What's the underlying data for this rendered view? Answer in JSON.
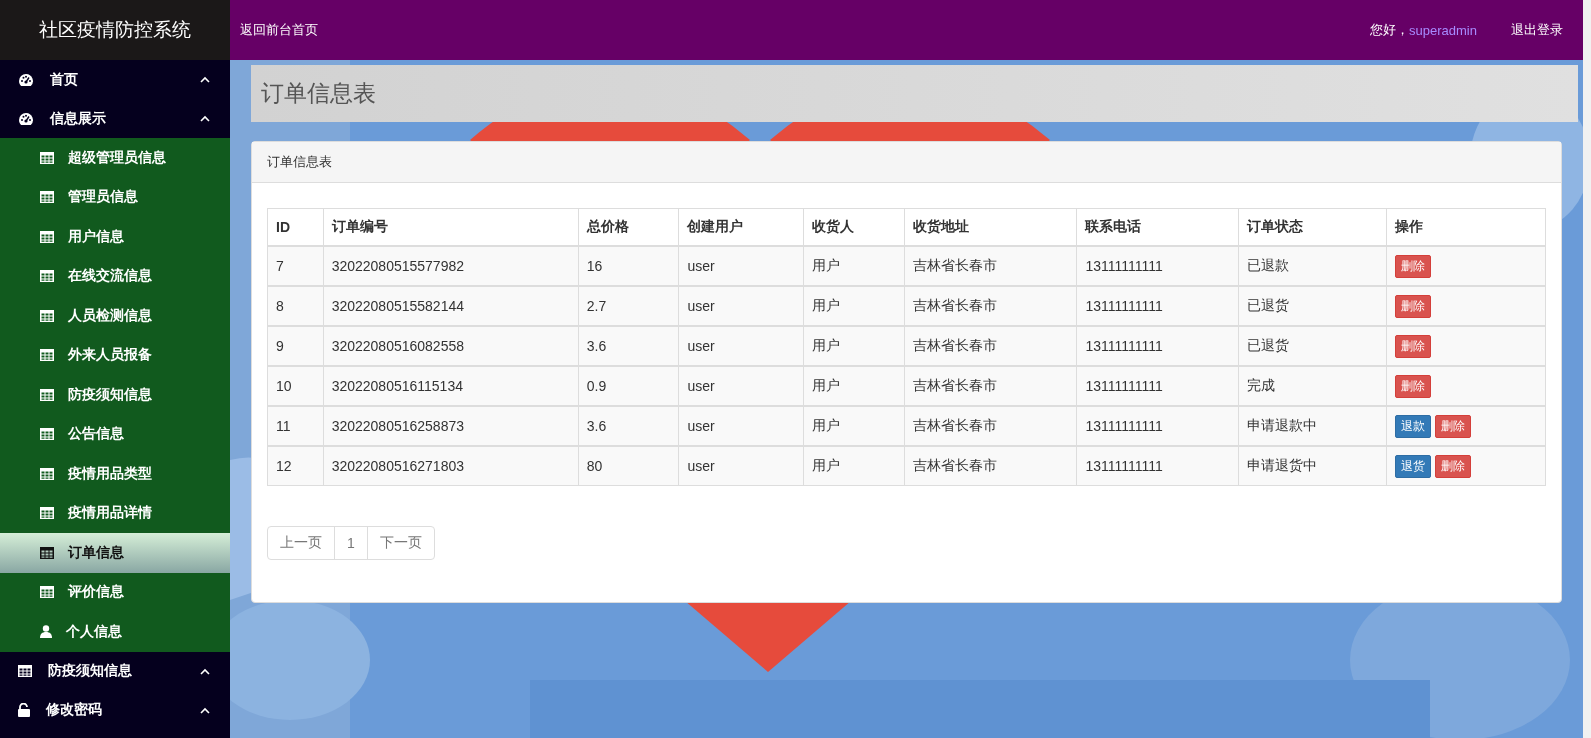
{
  "sidebar": {
    "brand": "社区疫情防控系统",
    "menu": [
      {
        "label": "首页",
        "kind": "dashboard"
      },
      {
        "label": "信息展示",
        "kind": "dashboard",
        "children": [
          {
            "label": "超级管理员信息",
            "kind": "table",
            "selected": false
          },
          {
            "label": "管理员信息",
            "kind": "table",
            "selected": false
          },
          {
            "label": "用户信息",
            "kind": "table",
            "selected": false
          },
          {
            "label": "在线交流信息",
            "kind": "table",
            "selected": false
          },
          {
            "label": "人员检测信息",
            "kind": "table",
            "selected": false
          },
          {
            "label": "外来人员报备",
            "kind": "table",
            "selected": false
          },
          {
            "label": "防疫须知信息",
            "kind": "table",
            "selected": false
          },
          {
            "label": "公告信息",
            "kind": "table",
            "selected": false
          },
          {
            "label": "疫情用品类型",
            "kind": "table",
            "selected": false
          },
          {
            "label": "疫情用品详情",
            "kind": "table",
            "selected": false
          },
          {
            "label": "订单信息",
            "kind": "table",
            "selected": true
          },
          {
            "label": "评价信息",
            "kind": "table",
            "selected": false
          },
          {
            "label": "个人信息",
            "kind": "user",
            "selected": false
          }
        ]
      },
      {
        "label": "防疫须知信息",
        "kind": "table"
      },
      {
        "label": "修改密码",
        "kind": "lock"
      }
    ]
  },
  "header": {
    "home_link": "返回前台首页",
    "greeting": "您好，",
    "username": "superadmin",
    "logout": "退出登录"
  },
  "page_title": "订单信息表",
  "panel": {
    "heading": "订单信息表",
    "table": {
      "columns": [
        "ID",
        "订单编号",
        "总价格",
        "创建用户",
        "收货人",
        "收货地址",
        "联系电话",
        "订单状态",
        "操作"
      ],
      "rows": [
        {
          "cells": [
            "7",
            "32022080515577982",
            "16",
            "user",
            "用户",
            "吉林省长春市",
            "13111111111",
            "已退款"
          ],
          "actions": [
            {
              "label": "删除",
              "kind": "danger"
            }
          ]
        },
        {
          "cells": [
            "8",
            "32022080515582144",
            "2.7",
            "user",
            "用户",
            "吉林省长春市",
            "13111111111",
            "已退货"
          ],
          "actions": [
            {
              "label": "删除",
              "kind": "danger"
            }
          ]
        },
        {
          "cells": [
            "9",
            "32022080516082558",
            "3.6",
            "user",
            "用户",
            "吉林省长春市",
            "13111111111",
            "已退货"
          ],
          "actions": [
            {
              "label": "删除",
              "kind": "danger"
            }
          ]
        },
        {
          "cells": [
            "10",
            "32022080516115134",
            "0.9",
            "user",
            "用户",
            "吉林省长春市",
            "13111111111",
            "完成"
          ],
          "actions": [
            {
              "label": "删除",
              "kind": "danger"
            }
          ]
        },
        {
          "cells": [
            "11",
            "32022080516258873",
            "3.6",
            "user",
            "用户",
            "吉林省长春市",
            "13111111111",
            "申请退款中"
          ],
          "actions": [
            {
              "label": "退款",
              "kind": "primary"
            },
            {
              "label": "删除",
              "kind": "danger"
            }
          ]
        },
        {
          "cells": [
            "12",
            "32022080516271803",
            "80",
            "user",
            "用户",
            "吉林省长春市",
            "13111111111",
            "申请退货中"
          ],
          "actions": [
            {
              "label": "退货",
              "kind": "primary"
            },
            {
              "label": "删除",
              "kind": "danger"
            }
          ]
        }
      ]
    },
    "pagination": [
      "上一页",
      "1",
      "下一页"
    ]
  }
}
